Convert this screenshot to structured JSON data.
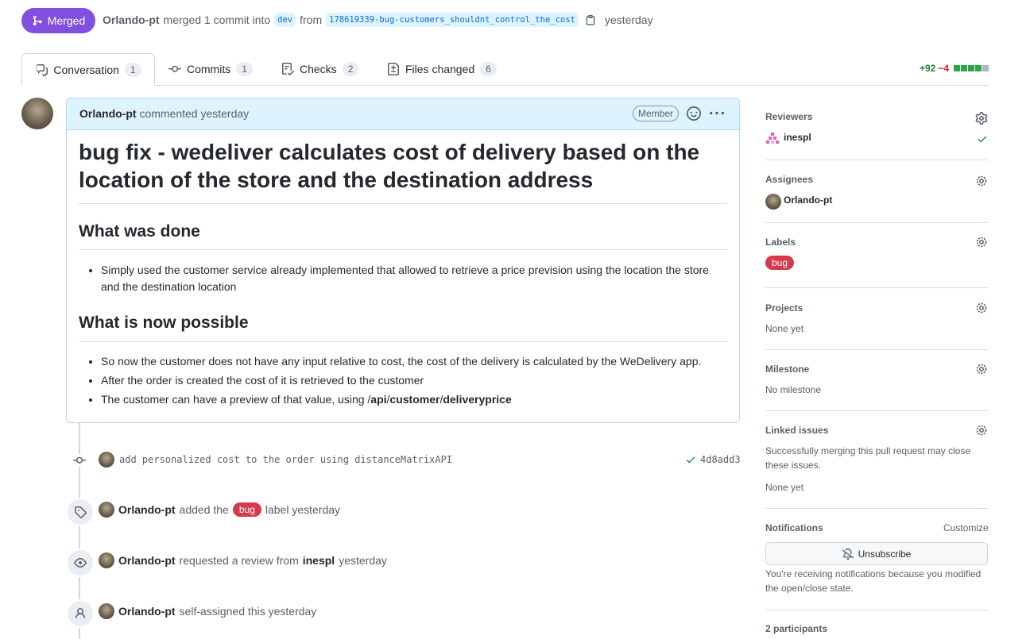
{
  "header": {
    "state_label": "Merged",
    "author": "Orlando-pt",
    "action_text": "merged 1 commit into",
    "base_branch": "dev",
    "from_text": "from",
    "head_branch": "178619339-bug-customers_shouldnt_control_the_cost",
    "time": "yesterday"
  },
  "tabs": [
    {
      "label": "Conversation",
      "count": "1",
      "icon": "comment-discussion-icon"
    },
    {
      "label": "Commits",
      "count": "1",
      "icon": "git-commit-icon"
    },
    {
      "label": "Checks",
      "count": "2",
      "icon": "checklist-icon"
    },
    {
      "label": "Files changed",
      "count": "6",
      "icon": "file-diff-icon"
    }
  ],
  "diffstat": {
    "additions": "+92",
    "deletions": "−4",
    "colors": [
      "#2da44e",
      "#2da44e",
      "#2da44e",
      "#2da44e",
      "#afb8c1"
    ]
  },
  "comment": {
    "author": "Orlando-pt",
    "meta": "commented yesterday",
    "role_badge": "Member",
    "title": "bug fix - wedeliver calculates cost of delivery based on the location of the store and the destination address",
    "section1_heading": "What was done",
    "section1_items": [
      "Simply used the customer service already implemented that allowed to retrieve a price prevision using the location the store and the destination location"
    ],
    "section2_heading": "What is now possible",
    "section2_items": [
      "So now the customer does not have any input relative to cost, the cost of the delivery is calculated by the WeDelivery app.",
      "After the order is created the cost of it is retrieved to the customer"
    ],
    "section2_last_prefix": "The customer can have a preview of that value, using ",
    "api_path": {
      "p1": "/",
      "p2": "api",
      "p3": "/",
      "p4": "customer",
      "p5": "/",
      "p6": "deliveryprice"
    }
  },
  "timeline": {
    "commit_message": "add personalized cost to the order using distanceMatrixAPI",
    "commit_sha": "4d8add3",
    "events": [
      {
        "actor": "Orlando-pt",
        "pre": "added the",
        "label": "bug",
        "post": "label yesterday"
      },
      {
        "actor": "Orlando-pt",
        "pre": "requested a review from",
        "target": "inespl",
        "post": "yesterday"
      },
      {
        "actor": "Orlando-pt",
        "pre": "self-assigned this yesterday"
      }
    ]
  },
  "sidebar": {
    "reviewers": {
      "title": "Reviewers",
      "name": "inespl"
    },
    "assignees": {
      "title": "Assignees",
      "name": "Orlando-pt"
    },
    "labels": {
      "title": "Labels",
      "label": "bug",
      "label_color": "#d73a4a"
    },
    "projects": {
      "title": "Projects",
      "value": "None yet"
    },
    "milestone": {
      "title": "Milestone",
      "value": "No milestone"
    },
    "linked_issues": {
      "title": "Linked issues",
      "description": "Successfully merging this pull request may close these issues.",
      "value": "None yet"
    },
    "notifications": {
      "title": "Notifications",
      "customize": "Customize",
      "button": "Unsubscribe",
      "reason": "You're receiving notifications because you modified the open/close state."
    },
    "participants": {
      "title": "2 participants"
    }
  }
}
